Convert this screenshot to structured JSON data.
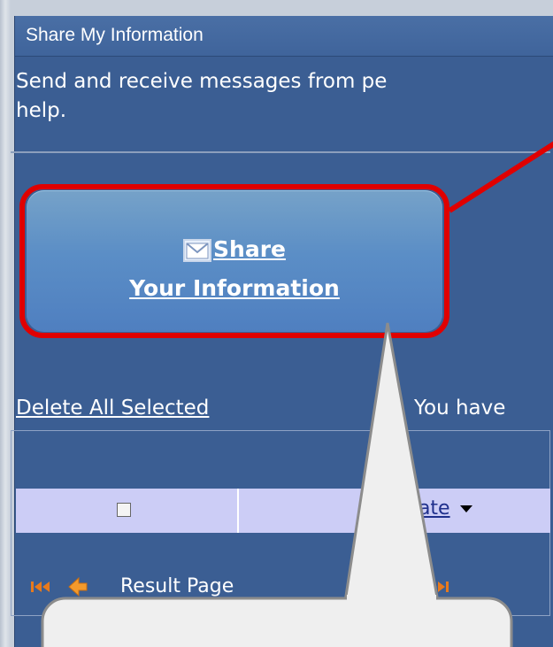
{
  "window": {
    "title": "Share My Information"
  },
  "description": {
    "line1": "Send and receive messages from pe",
    "line2": "help."
  },
  "share_button": {
    "line1": "Share",
    "line2": "Your Information",
    "icon": "envelope-icon"
  },
  "toolbar": {
    "delete_label": "Delete All Selected",
    "status_text": "You have"
  },
  "grid": {
    "columns": [
      {
        "type": "checkbox"
      },
      {
        "label": "Date",
        "sort": "descending"
      }
    ]
  },
  "pager": {
    "label": "Result Page",
    "icons": [
      "first-page-icon",
      "previous-page-icon",
      "next-page-icon"
    ]
  },
  "colors": {
    "panel": "#3b5e93",
    "highlight": "#e00000",
    "header_row": "#cccdf6",
    "link_dark": "#1e2f8c",
    "pager_icon": "#e87a1c"
  }
}
